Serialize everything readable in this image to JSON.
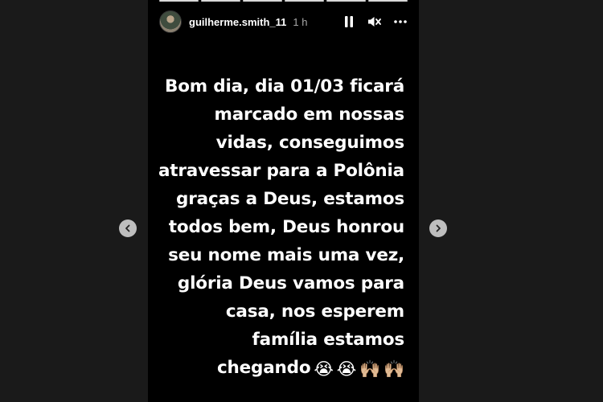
{
  "story": {
    "progress_segments": 6,
    "header": {
      "username": "guilherme.smith_11",
      "time": "1 h"
    },
    "caption_lines": [
      "Bom dia, dia 01/03 ficará",
      "marcado em nossas",
      "vidas, conseguimos",
      "atravessar para a Polônia",
      "graças a Deus, estamos",
      "todos bem, Deus honrou",
      "seu nome mais uma vez,",
      "glória Deus vamos para",
      "casa, nos esperem",
      "família estamos",
      "chegando"
    ],
    "caption_emojis": [
      "😭",
      "😭",
      "🙌🏼",
      "🙌🏼"
    ]
  },
  "icons": {
    "pause": "pause-icon",
    "mute": "mute-icon",
    "more": "more-icon",
    "prev": "chevron-left-icon",
    "next": "chevron-right-icon"
  }
}
